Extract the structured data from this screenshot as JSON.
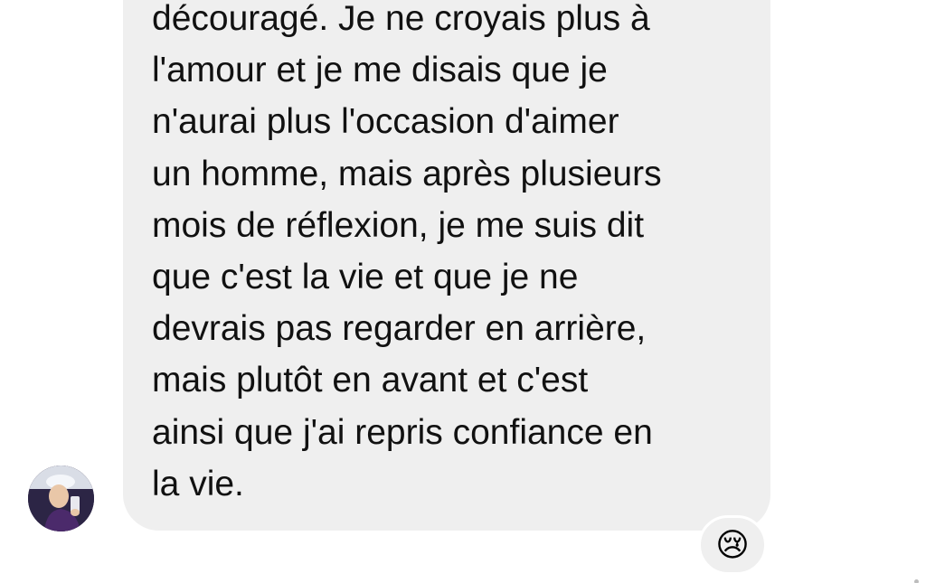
{
  "message": {
    "lines": [
      "découragé. Je ne croyais plus à",
      "l'amour et je me disais que je",
      "n'aurai plus l'occasion d'aimer",
      "un homme, mais après plusieurs",
      "mois de réflexion, je me suis dit",
      "que c'est la vie et que je ne",
      "devrais pas regarder en arrière,",
      "mais plutôt en avant et c'est",
      "ainsi que j'ai repris confiance en",
      "la vie."
    ]
  },
  "reaction": {
    "emoji": "😢",
    "icon": "crying-face-emoji-icon"
  },
  "avatar": {
    "icon": "user-avatar-photo"
  },
  "colors": {
    "bubble": "#efefef",
    "text": "#111111",
    "background": "#ffffff"
  }
}
